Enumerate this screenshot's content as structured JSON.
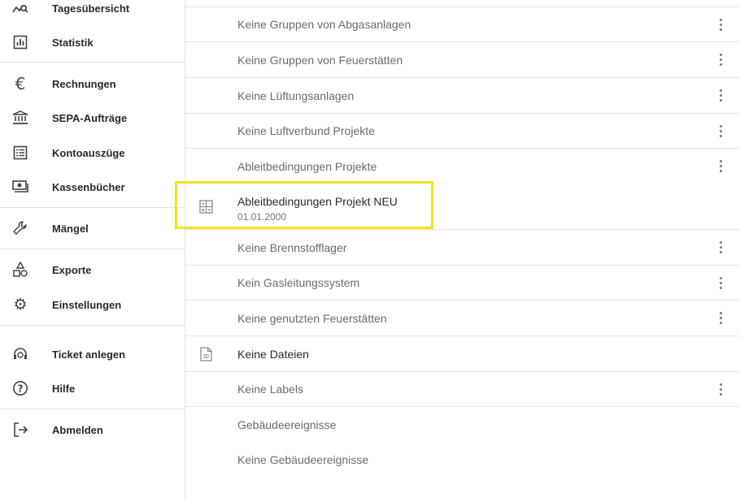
{
  "sidebar": {
    "items": [
      {
        "label": "Tagesübersicht",
        "icon": "chart-search-icon"
      },
      {
        "label": "Statistik",
        "icon": "bar-chart-icon"
      },
      {
        "label": "Rechnungen",
        "icon": "euro-icon"
      },
      {
        "label": "SEPA-Aufträge",
        "icon": "bank-icon"
      },
      {
        "label": "Kontoauszüge",
        "icon": "list-document-icon"
      },
      {
        "label": "Kassenbücher",
        "icon": "cash-icon"
      },
      {
        "label": "Mängel",
        "icon": "wrench-icon"
      },
      {
        "label": "Exporte",
        "icon": "shapes-icon"
      },
      {
        "label": "Einstellungen",
        "icon": "gear-icon"
      },
      {
        "label": "Ticket anlegen",
        "icon": "support-agent-icon"
      },
      {
        "label": "Hilfe",
        "icon": "help-icon"
      },
      {
        "label": "Abmelden",
        "icon": "logout-icon"
      }
    ]
  },
  "main": {
    "rows": [
      {
        "text": "Keine Gruppen von Abgasanlagen"
      },
      {
        "text": "Keine Gruppen von Feuerstätten"
      },
      {
        "text": "Keine Lüftungsanlagen"
      },
      {
        "text": "Keine Luftverbund Projekte"
      },
      {
        "text": "Ableitbedingungen Projekte"
      },
      {
        "title": "Ableitbedingungen Projekt NEU",
        "date": "01.01.2000",
        "icon": "calculator-icon"
      },
      {
        "text": "Keine Brennstofflager"
      },
      {
        "text": "Kein Gasleitungssystem"
      },
      {
        "text": "Keine genutzten Feuerstätten"
      },
      {
        "text": "Keine Dateien",
        "icon": "document-icon"
      },
      {
        "text": "Keine Labels"
      },
      {
        "text": "Gebäudeereignisse"
      },
      {
        "text": "Keine Gebäudeereignisse"
      }
    ]
  },
  "colors": {
    "highlight": "#f5e21b",
    "divider": "#e6e6e6"
  }
}
